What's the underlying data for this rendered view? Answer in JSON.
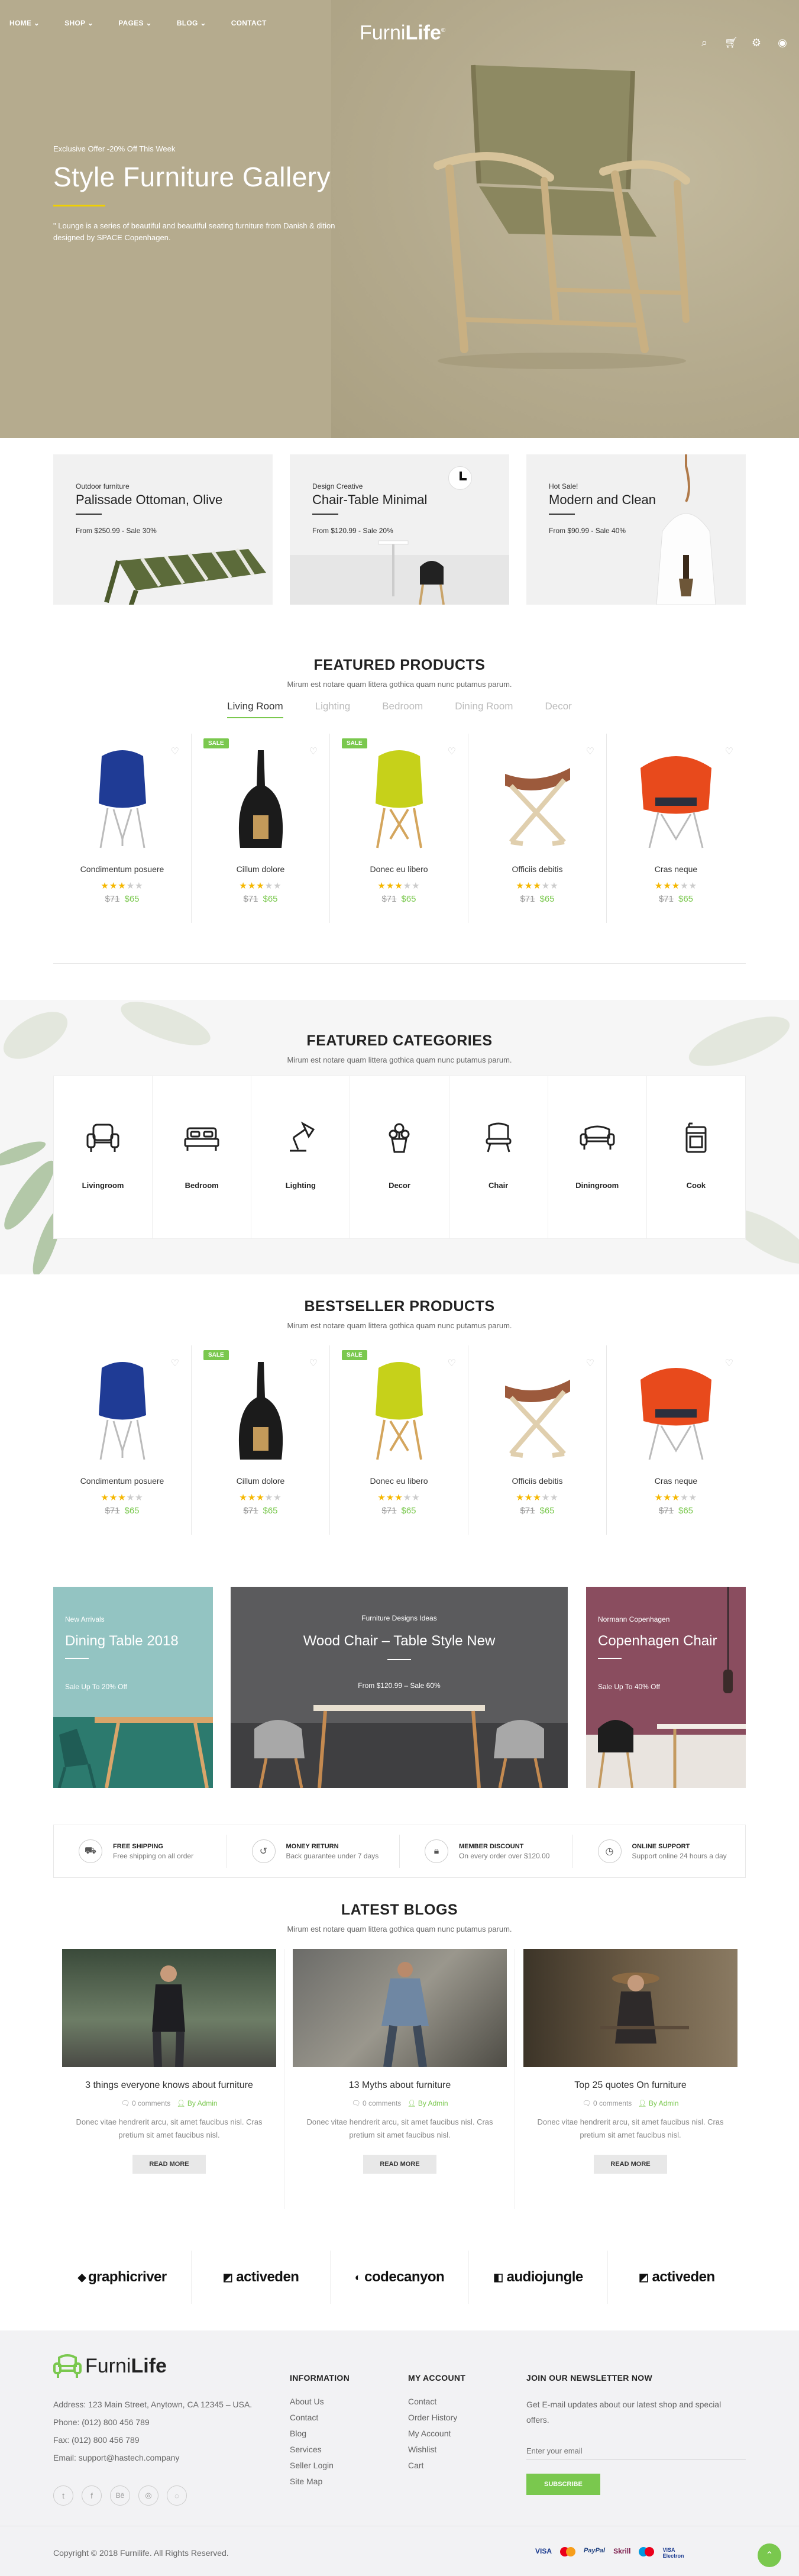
{
  "nav": {
    "items": [
      "HOME",
      "SHOP",
      "PAGES",
      "BLOG",
      "CONTACT"
    ],
    "logo_a": "Furni",
    "logo_b": "Life"
  },
  "hero": {
    "offer": "Exclusive Offer -20% Off This Week",
    "title": "Style Furniture Gallery",
    "desc": "\" Lounge is a series of beautiful and beautiful seating furniture from Danish & dition designed by SPACE Copenhagen."
  },
  "promos": [
    {
      "small": "Outdoor furniture",
      "title": "Palissade Ottoman, Olive",
      "price": "From  $250.99 - Sale 30%"
    },
    {
      "small": "Design Creative",
      "title": "Chair-Table Minimal",
      "price": "From  $120.99 - Sale 20%"
    },
    {
      "small": "Hot Sale!",
      "title": "Modern and Clean",
      "price": "From  $90.99 - Sale 40%"
    }
  ],
  "featured": {
    "title": "FEATURED PRODUCTS",
    "sub": "Mirum est notare quam littera gothica quam nunc putamus parum.",
    "tabs": [
      "Living Room",
      "Lighting",
      "Bedroom",
      "Dining Room",
      "Decor"
    ]
  },
  "products": [
    {
      "name": "Condimentum posuere",
      "old": "$71",
      "new": "$65",
      "sale": "",
      "rating": 3
    },
    {
      "name": "Cillum dolore",
      "old": "$71",
      "new": "$65",
      "sale": "SALE",
      "rating": 3
    },
    {
      "name": "Donec eu libero",
      "old": "$71",
      "new": "$65",
      "sale": "SALE",
      "rating": 3
    },
    {
      "name": "Officiis debitis",
      "old": "$71",
      "new": "$65",
      "sale": "",
      "rating": 3
    },
    {
      "name": "Cras neque",
      "old": "$71",
      "new": "$65",
      "sale": "",
      "rating": 3
    }
  ],
  "categories": {
    "title": "FEATURED CATEGORIES",
    "sub": "Mirum est notare quam littera gothica quam nunc putamus parum.",
    "items": [
      "Livingroom",
      "Bedroom",
      "Lighting",
      "Decor",
      "Chair",
      "Diningroom",
      "Cook"
    ]
  },
  "bestseller": {
    "title": "BESTSELLER PRODUCTS",
    "sub": "Mirum est notare quam littera gothica quam nunc putamus parum."
  },
  "banners": [
    {
      "small": "New Arrivals",
      "title": "Dining Table 2018",
      "sale": "Sale Up To 20% Off"
    },
    {
      "small": "Furniture Designs Ideas",
      "title": "Wood Chair – Table Style New",
      "sale": "From $120.99 – Sale 60%"
    },
    {
      "small": "Normann Copenhagen",
      "title": "Copenhagen Chair",
      "sale": "Sale Up To 40% Off"
    }
  ],
  "services": [
    {
      "title": "FREE SHIPPING",
      "sub": "Free shipping on all order"
    },
    {
      "title": "MONEY RETURN",
      "sub": "Back guarantee under 7 days"
    },
    {
      "title": "MEMBER DISCOUNT",
      "sub": "On every order over $120.00"
    },
    {
      "title": "ONLINE SUPPORT",
      "sub": "Support online 24 hours a day"
    }
  ],
  "blogs": {
    "title": "LATEST BLOGS",
    "sub": "Mirum est notare quam littera gothica quam nunc putamus parum.",
    "items": [
      {
        "title": "3 things everyone knows about furniture",
        "comments": "0 comments",
        "author": "By Admin",
        "excerpt": "Donec vitae hendrerit arcu, sit amet faucibus nisl. Cras pretium sit amet faucibus nisl.",
        "button": "READ MORE"
      },
      {
        "title": "13 Myths about furniture",
        "comments": "0 comments",
        "author": "By Admin",
        "excerpt": "Donec vitae hendrerit arcu, sit amet faucibus nisl. Cras pretium sit amet faucibus nisl.",
        "button": "READ MORE"
      },
      {
        "title": "Top 25 quotes On furniture",
        "comments": "0 comments",
        "author": "By Admin",
        "excerpt": "Donec vitae hendrerit arcu, sit amet faucibus nisl. Cras pretium sit amet faucibus nisl.",
        "button": "READ MORE"
      }
    ]
  },
  "brands": [
    "graphicriver",
    "activeden",
    "codecanyon",
    "audiojungle",
    "activeden"
  ],
  "footer": {
    "logo_a": "Furni",
    "logo_b": "Life",
    "address": "Address: 123 Main Street, Anytown, CA 12345 – USA.",
    "phone": "Phone: (012) 800 456 789",
    "fax": "Fax: (012) 800 456 789",
    "email": "Email: support@hastech.company",
    "info_title": "INFORMATION",
    "info_links": [
      "About Us",
      "Contact",
      "Blog",
      "Services",
      "Seller Login",
      "Site Map"
    ],
    "account_title": "MY ACCOUNT",
    "account_links": [
      "Contact",
      "Order History",
      "My Account",
      "Wishlist",
      "Cart"
    ],
    "news_title": "JOIN OUR NEWSLETTER NOW",
    "news_text": "Get E-mail updates about our latest shop and special offers.",
    "email_placeholder": "Enter your email",
    "subscribe": "SUBSCRIBE",
    "copyright": "Copyright © 2018 Furnilife. All Rights Reserved.",
    "payments": [
      "VISA",
      "MC",
      "PayPal",
      "Skrill",
      "Maestro",
      "VISA Electron"
    ]
  },
  "colors": {
    "accent": "#7ac84e",
    "hero_bg": "#b5ab8e",
    "star": "#f5b700"
  }
}
